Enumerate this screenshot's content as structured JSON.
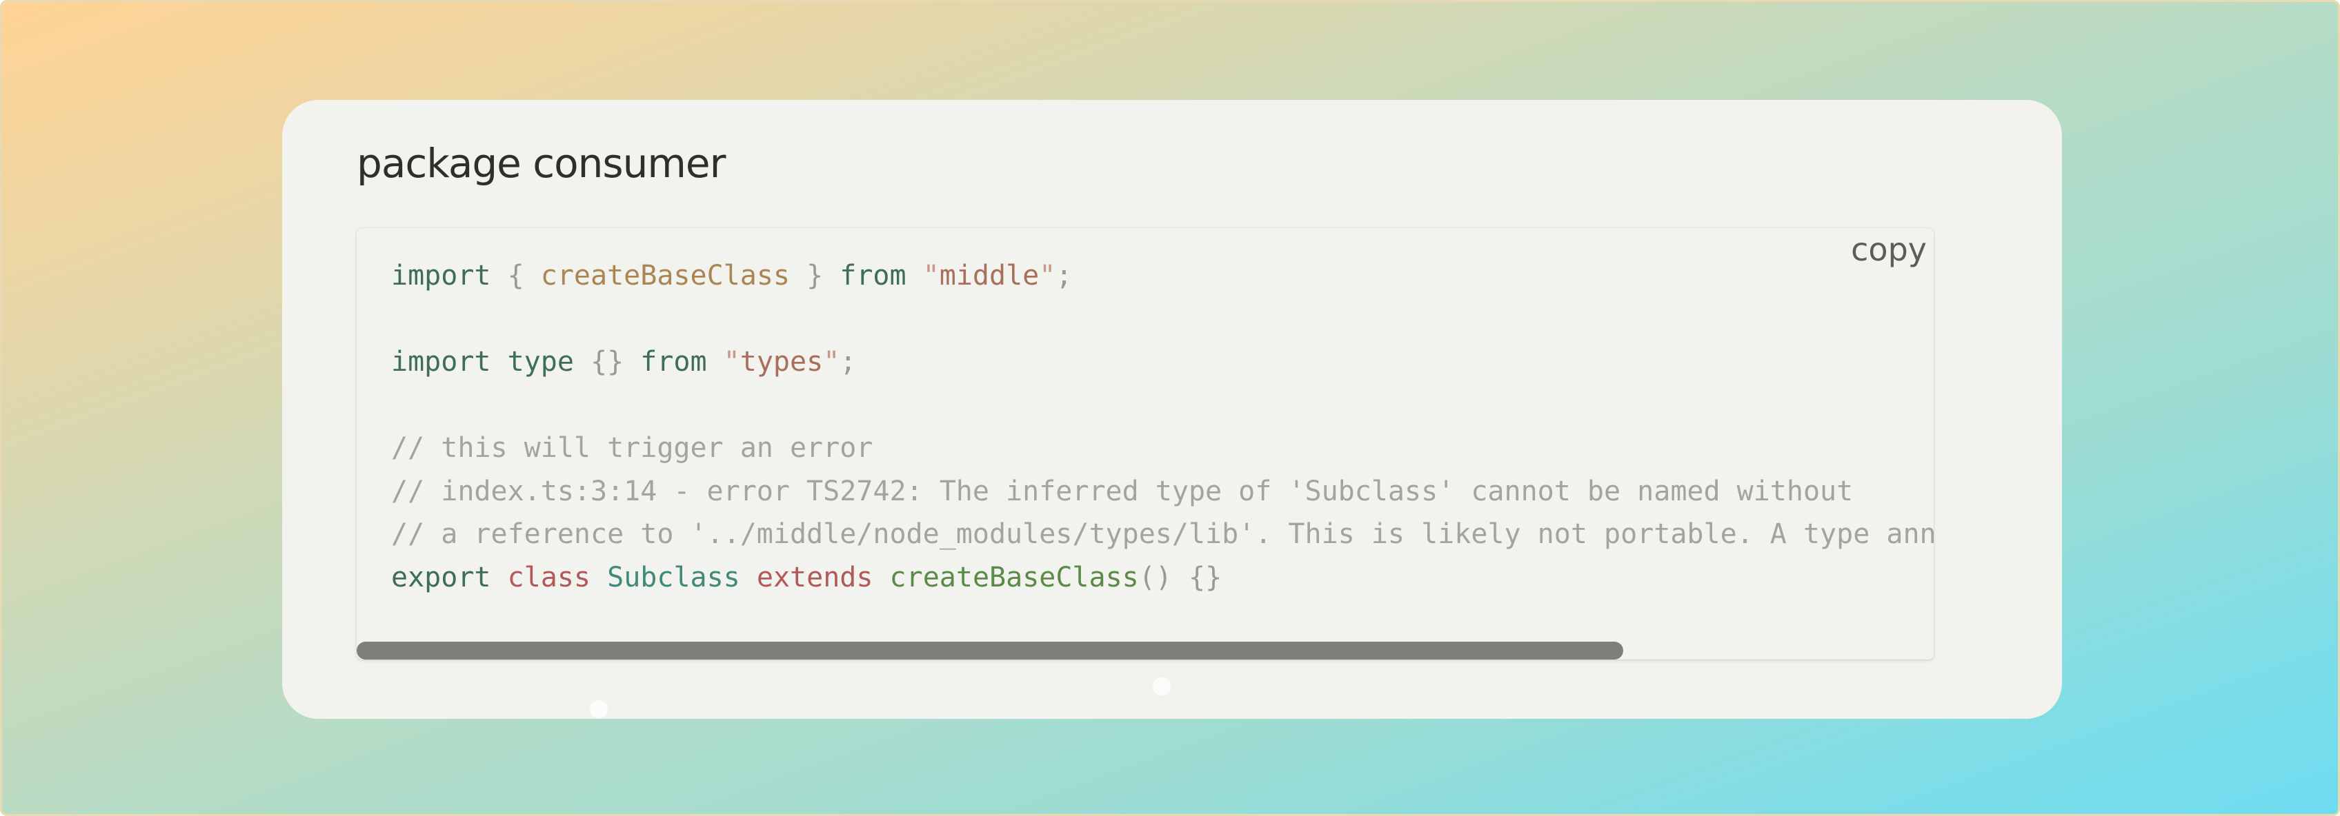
{
  "card": {
    "title": "package consumer",
    "copy_label": "copy"
  },
  "code_lines": [
    [
      {
        "t": "import",
        "c": "kw"
      },
      {
        "t": " { ",
        "c": "punct"
      },
      {
        "t": "createBaseClass",
        "c": "ident"
      },
      {
        "t": " } ",
        "c": "punct"
      },
      {
        "t": "from",
        "c": "kw"
      },
      {
        "t": " ",
        "c": "punct"
      },
      {
        "t": "\"",
        "c": "strq"
      },
      {
        "t": "middle",
        "c": "str"
      },
      {
        "t": "\"",
        "c": "strq"
      },
      {
        "t": ";",
        "c": "punct"
      }
    ],
    [],
    [
      {
        "t": "import",
        "c": "kw"
      },
      {
        "t": " ",
        "c": "punct"
      },
      {
        "t": "type",
        "c": "kw"
      },
      {
        "t": " {} ",
        "c": "punct"
      },
      {
        "t": "from",
        "c": "kw"
      },
      {
        "t": " ",
        "c": "punct"
      },
      {
        "t": "\"",
        "c": "strq"
      },
      {
        "t": "types",
        "c": "str"
      },
      {
        "t": "\"",
        "c": "strq"
      },
      {
        "t": ";",
        "c": "punct"
      }
    ],
    [],
    [
      {
        "t": "// this will trigger an error",
        "c": "comment"
      }
    ],
    [
      {
        "t": "// index.ts:3:14 - error TS2742: The inferred type of 'Subclass' cannot be named without",
        "c": "comment"
      }
    ],
    [
      {
        "t": "// a reference to '../middle/node_modules/types/lib'. This is likely not portable. A type annotation is necessary.",
        "c": "comment"
      }
    ],
    [
      {
        "t": "export",
        "c": "kw"
      },
      {
        "t": " ",
        "c": "punct"
      },
      {
        "t": "class",
        "c": "red"
      },
      {
        "t": " ",
        "c": "punct"
      },
      {
        "t": "Subclass",
        "c": "class"
      },
      {
        "t": " ",
        "c": "punct"
      },
      {
        "t": "extends",
        "c": "red"
      },
      {
        "t": " ",
        "c": "punct"
      },
      {
        "t": "createBaseClass",
        "c": "fn"
      },
      {
        "t": "() {}",
        "c": "punct"
      }
    ]
  ],
  "scroll": {
    "visible_fraction": 0.803
  }
}
